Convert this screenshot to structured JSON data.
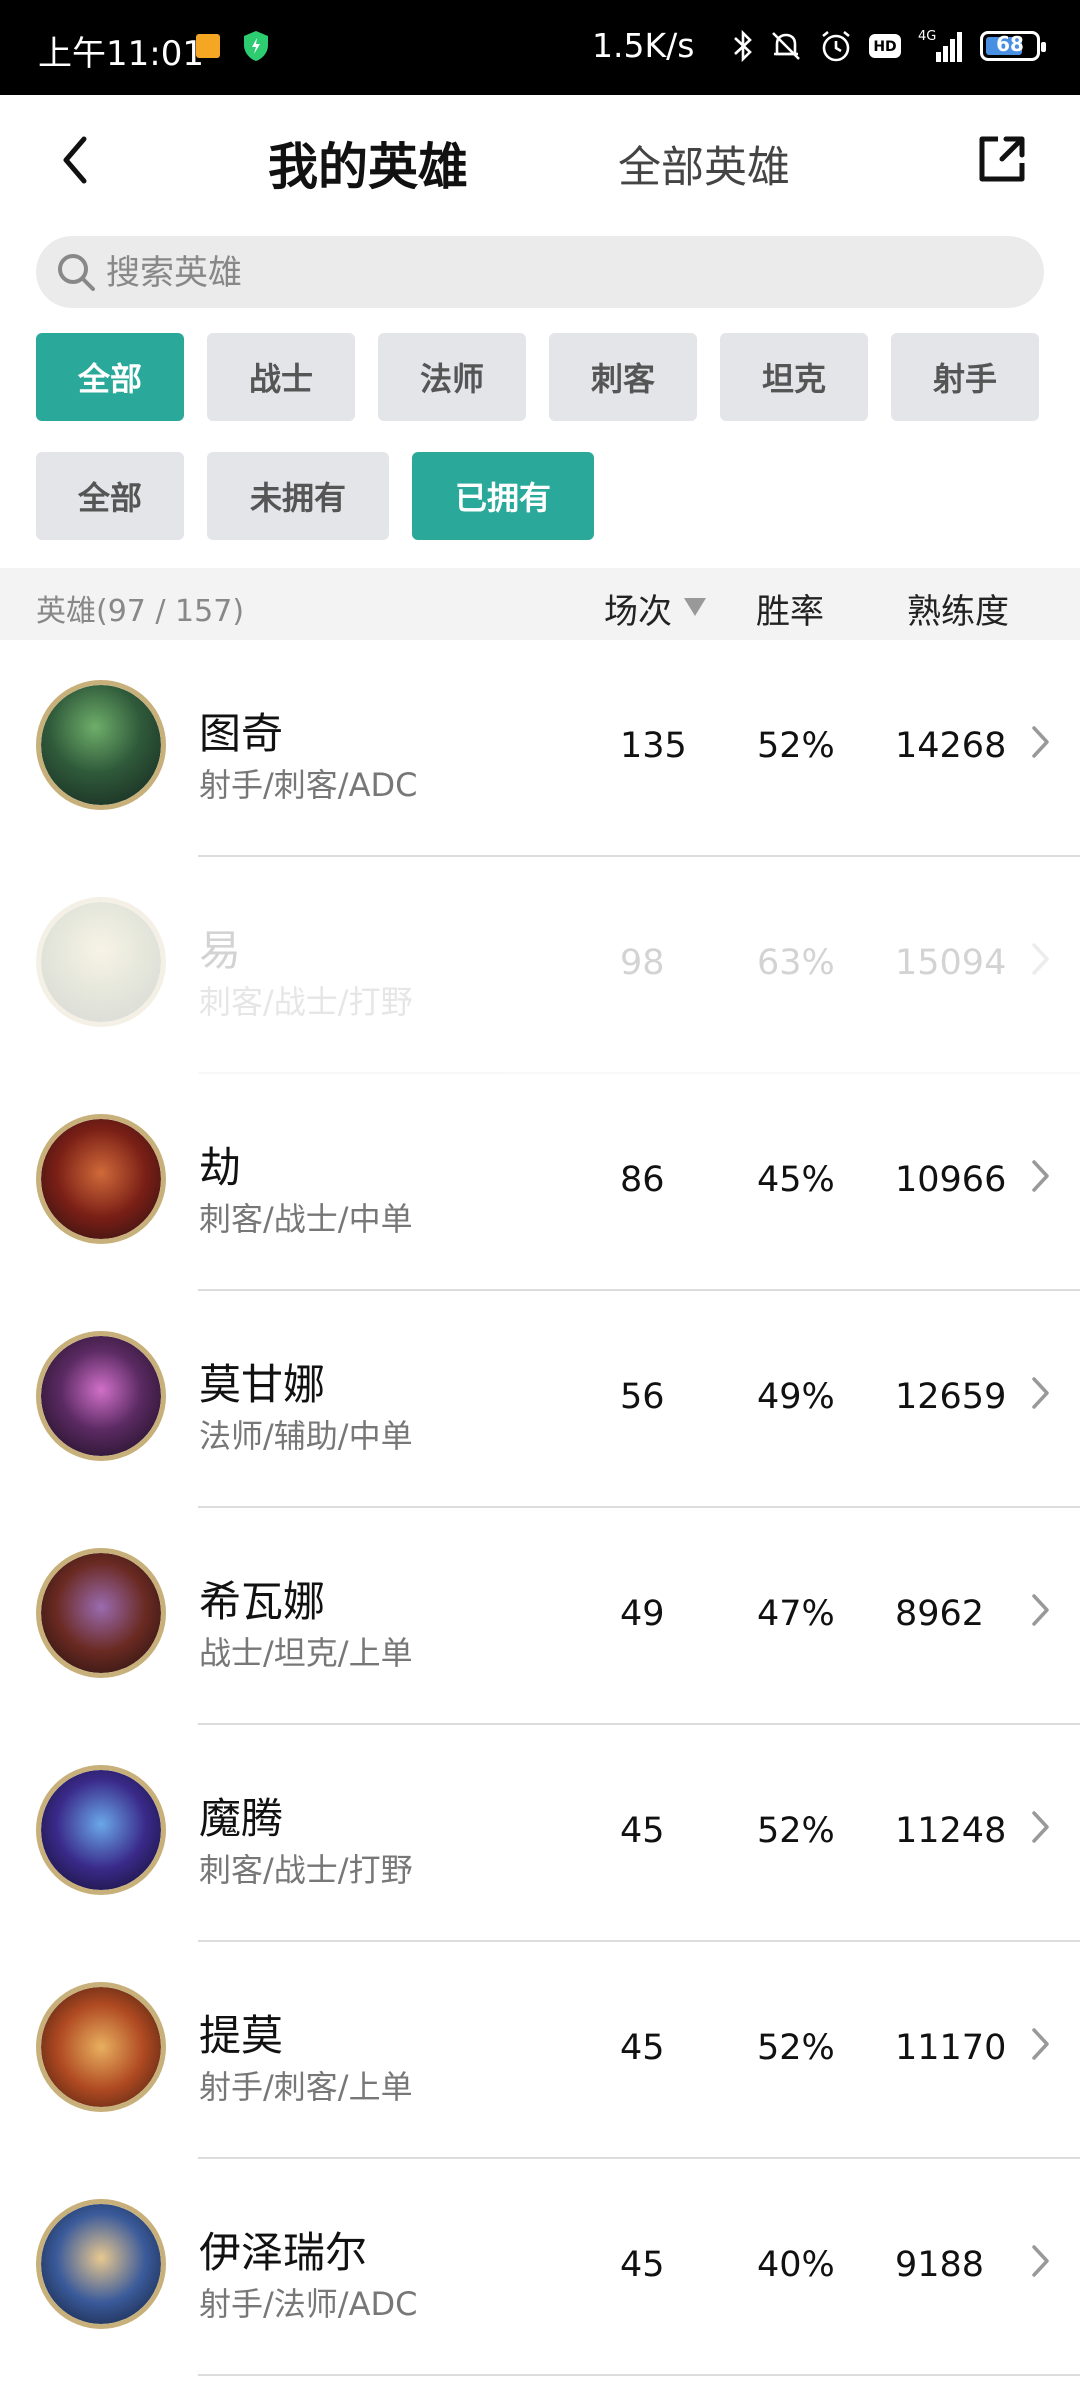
{
  "status_bar": {
    "time": "上午11:01",
    "net_speed": "1.5K/s",
    "network": "4G",
    "battery": "68"
  },
  "header": {
    "tab_mine": "我的英雄",
    "tab_all": "全部英雄"
  },
  "search": {
    "placeholder": "搜索英雄"
  },
  "filters": {
    "roles": [
      "全部",
      "战士",
      "法师",
      "刺客",
      "坦克",
      "射手"
    ],
    "ownership": [
      "全部",
      "未拥有",
      "已拥有"
    ]
  },
  "columns": {
    "count_label": "英雄(97 / 157)",
    "games": "场次",
    "winrate": "胜率",
    "mastery": "熟练度"
  },
  "heroes": [
    {
      "name": "图奇",
      "roles": "射手/刺客/ADC",
      "games": "135",
      "winrate": "52%",
      "mastery": "14268"
    },
    {
      "name": "易",
      "roles": "刺客/战士/打野",
      "games": "98",
      "winrate": "63%",
      "mastery": "15094"
    },
    {
      "name": "劫",
      "roles": "刺客/战士/中单",
      "games": "86",
      "winrate": "45%",
      "mastery": "10966"
    },
    {
      "name": "莫甘娜",
      "roles": "法师/辅助/中单",
      "games": "56",
      "winrate": "49%",
      "mastery": "12659"
    },
    {
      "name": "希瓦娜",
      "roles": "战士/坦克/上单",
      "games": "49",
      "winrate": "47%",
      "mastery": "8962"
    },
    {
      "name": "魔腾",
      "roles": "刺客/战士/打野",
      "games": "45",
      "winrate": "52%",
      "mastery": "11248"
    },
    {
      "name": "提莫",
      "roles": "射手/刺客/上单",
      "games": "45",
      "winrate": "52%",
      "mastery": "11170"
    },
    {
      "name": "伊泽瑞尔",
      "roles": "射手/法师/ADC",
      "games": "45",
      "winrate": "40%",
      "mastery": "9188"
    }
  ],
  "colors": {
    "accent": "#2aa99b",
    "chip_bg": "#e4e5e9",
    "avatar_ring": "#c8b07a"
  }
}
